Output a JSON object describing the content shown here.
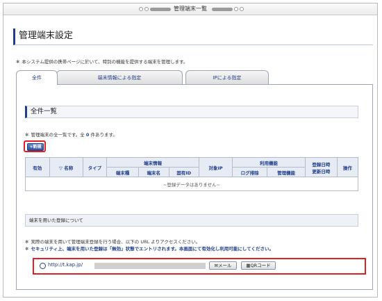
{
  "window": {
    "title": "管理端末一覧"
  },
  "page": {
    "title": "管理端末設定",
    "description": "本システム提供の携帯ページに於いて、特別の機能を提供する端末を管理します。"
  },
  "tabs": [
    {
      "label": "全件"
    },
    {
      "label": "端末情報による指定"
    },
    {
      "label": "IPによる指定"
    }
  ],
  "list_section": {
    "title": "全件一覧",
    "desc_prefix": "管理端末の全一覧です。全",
    "count": "0",
    "desc_suffix": "件あります。"
  },
  "new_button": {
    "label": "新規"
  },
  "table": {
    "headers": {
      "enabled": "有効",
      "name": "▽ 名称",
      "type": "タイプ",
      "terminal_info": "端末情報",
      "terminal_type": "端末種",
      "terminal_name": "端末名",
      "unique_id": "固有ID",
      "target_ip": "対象IP",
      "usage": "利用機能",
      "login_exclude": "ログ排除",
      "admin_function": "管理機能",
      "reg_date": "登録日時",
      "upd_date": "更新日時",
      "action": "操作"
    },
    "empty_message": "~登録データはありません~"
  },
  "registration": {
    "header": "端末を用いた登録について",
    "note1": "実際の端末を用いて管理端末登録を行う場合、以下の URL よりアクセスください。",
    "note2": "セキュリティ上、端末を用いた登録は「無効」状態でエントリされます。本画面にて有効化し利用可能にしてください。",
    "url": "http://t.kap.jp/",
    "mail_button": "メール",
    "qr_button": "QRコード"
  }
}
